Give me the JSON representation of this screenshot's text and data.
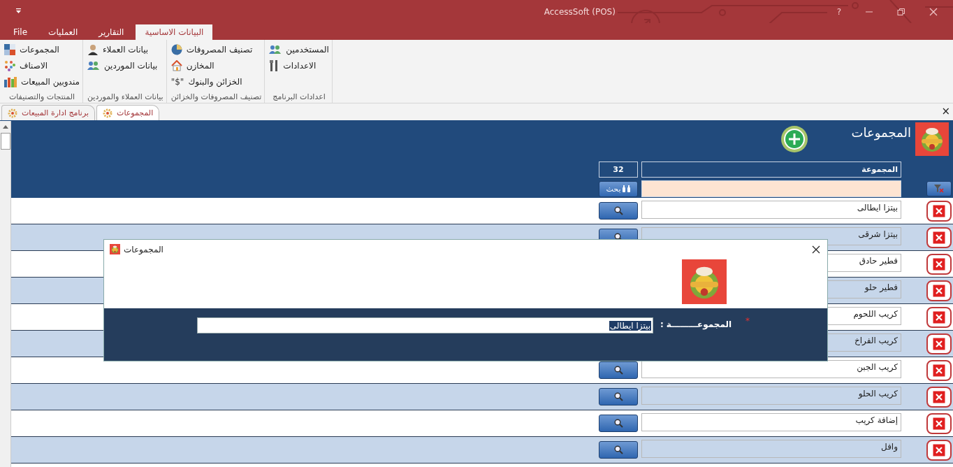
{
  "window": {
    "title": "AccessSoft (POS)",
    "help": "?"
  },
  "ribbon_tabs": [
    {
      "label": "البيانات الاساسية",
      "selected": true
    },
    {
      "label": "التقارير",
      "selected": false
    },
    {
      "label": "العمليات",
      "selected": false
    },
    {
      "label": "File",
      "selected": false
    }
  ],
  "ribbon_groups": [
    {
      "label": "اعدادات البرنامج",
      "items": [
        {
          "label": "المستخدمين",
          "kind": "users"
        },
        {
          "label": "الاعدادات",
          "kind": "tools"
        }
      ]
    },
    {
      "label": "تصنيف المصروفات والخزائن",
      "items": [
        {
          "label": "تصنيف المصروفات",
          "kind": "pie"
        },
        {
          "label": "المخازن",
          "kind": "house"
        },
        {
          "label": "الخزائن والبنوك",
          "kind": "dollar"
        }
      ]
    },
    {
      "label": "بيانات العملاء والموردين",
      "items": [
        {
          "label": "بيانات العملاء",
          "kind": "person"
        },
        {
          "label": "بيانات الموردين",
          "kind": "users"
        }
      ]
    },
    {
      "label": "المنتجات والتصنيفات",
      "items": [
        {
          "label": "المجموعات",
          "kind": "tiles"
        },
        {
          "label": "الاصناف",
          "kind": "dots"
        },
        {
          "label": "مندوبين المبيعات",
          "kind": "bars"
        }
      ]
    }
  ],
  "dollar_glyph": "\"$\"",
  "document_tabs": [
    {
      "label": "المجموعات",
      "selected": true
    },
    {
      "label": "برنامج ادارة المبيعات",
      "selected": false
    }
  ],
  "close_glyph": "×",
  "form": {
    "title": "المجموعات",
    "column_header": "المجموعة",
    "count": "32",
    "search_button": "بحث"
  },
  "rows": [
    {
      "name": "بيتزا ايطالى",
      "search_button": true
    },
    {
      "name": "بيتزا شرقى",
      "search_button": true
    },
    {
      "name": "فطير حادق",
      "search_button": false
    },
    {
      "name": "فطير حلو",
      "search_button": false
    },
    {
      "name": "كريب اللحوم",
      "search_button": false
    },
    {
      "name": "كريب الفراخ",
      "search_button": false
    },
    {
      "name": "كريب الجبن",
      "search_button": true
    },
    {
      "name": "كريب الحلو",
      "search_button": true
    },
    {
      "name": "إضافة كريب",
      "search_button": true
    },
    {
      "name": "وافل",
      "search_button": true
    }
  ],
  "dialog": {
    "title": "المجموعات",
    "required_mark": "*",
    "label": "المجموعـــــــــة",
    "separator": ":",
    "value": "بيتزا ايطالى",
    "value_selected": true
  }
}
